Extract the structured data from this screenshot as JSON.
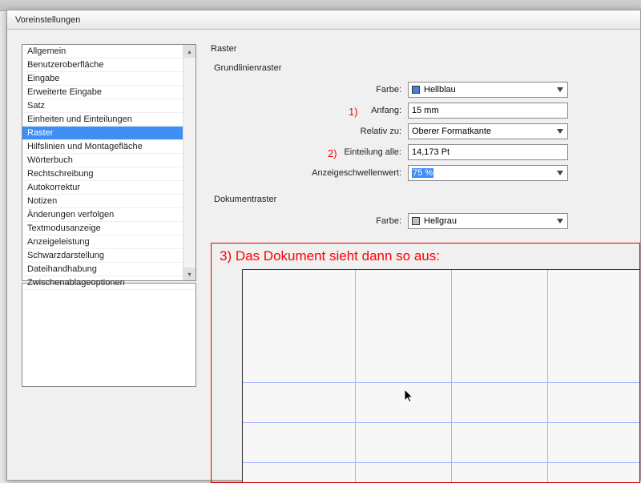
{
  "dialog": {
    "title": "Voreinstellungen"
  },
  "sidebar": {
    "items": [
      {
        "label": "Allgemein"
      },
      {
        "label": "Benutzeroberfläche"
      },
      {
        "label": "Eingabe"
      },
      {
        "label": "Erweiterte Eingabe"
      },
      {
        "label": "Satz"
      },
      {
        "label": "Einheiten und Einteilungen"
      },
      {
        "label": "Raster"
      },
      {
        "label": "Hilfslinien und Montagefläche"
      },
      {
        "label": "Wörterbuch"
      },
      {
        "label": "Rechtschreibung"
      },
      {
        "label": "Autokorrektur"
      },
      {
        "label": "Notizen"
      },
      {
        "label": "Änderungen verfolgen"
      },
      {
        "label": "Textmodusanzeige"
      },
      {
        "label": "Anzeigeleistung"
      },
      {
        "label": "Schwarzdarstellung"
      },
      {
        "label": "Dateihandhabung"
      },
      {
        "label": "Zwischenablageoptionen"
      }
    ],
    "selected_index": 6
  },
  "panel": {
    "title": "Raster",
    "baseline_group": {
      "label": "Grundlinienraster",
      "color_label": "Farbe:",
      "color_value": "Hellblau",
      "color_hex": "#4a7fd6",
      "start_label": "Anfang:",
      "start_value": "15 mm",
      "relative_label": "Relativ zu:",
      "relative_value": "Oberer Formatkante",
      "increment_label": "Einteilung alle:",
      "increment_value": "14,173 Pt",
      "threshold_label": "Anzeigeschwellenwert:",
      "threshold_value": "75 %"
    },
    "doc_group": {
      "label": "Dokumentraster",
      "color_label": "Farbe:",
      "color_value": "Hellgrau",
      "color_hex": "#bfbfbf"
    }
  },
  "annotations": {
    "a1": "1)",
    "a2": "2)",
    "a3": "3) Das Dokument sieht dann so aus:"
  }
}
